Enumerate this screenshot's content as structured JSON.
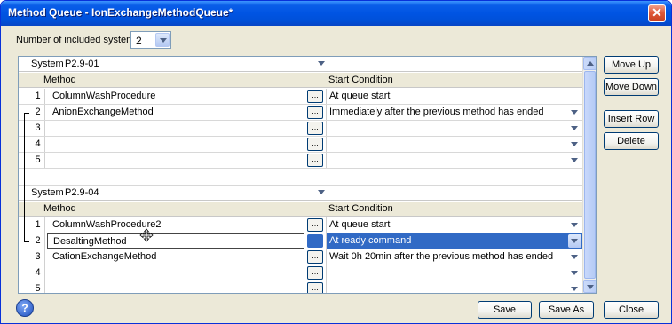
{
  "window": {
    "title": "Method Queue - IonExchangeMethodQueue*",
    "close_glyph": "✕"
  },
  "systems_count": {
    "label": "Number of included systems:",
    "value": "2"
  },
  "groups": [
    {
      "system_label": "System",
      "system_value": "P2.9-01",
      "col_method": "Method",
      "col_start": "Start Condition",
      "rows": [
        {
          "num": "1",
          "method": "ColumnWashProcedure",
          "cond": "At queue start"
        },
        {
          "num": "2",
          "method": "AnionExchangeMethod",
          "cond": "Immediately after the previous method has ended"
        },
        {
          "num": "3",
          "method": "",
          "cond": ""
        },
        {
          "num": "4",
          "method": "",
          "cond": ""
        },
        {
          "num": "5",
          "method": "",
          "cond": ""
        }
      ]
    },
    {
      "system_label": "System",
      "system_value": "P2.9-04",
      "col_method": "Method",
      "col_start": "Start Condition",
      "rows": [
        {
          "num": "1",
          "method": "ColumnWashProcedure2",
          "cond": "At queue start"
        },
        {
          "num": "2",
          "method": "DesaltingMethod",
          "cond": "At ready command"
        },
        {
          "num": "3",
          "method": "CationExchangeMethod",
          "cond": "Wait 0h 20min after the previous method has ended"
        },
        {
          "num": "4",
          "method": "",
          "cond": ""
        },
        {
          "num": "5",
          "method": "",
          "cond": ""
        }
      ]
    }
  ],
  "ellipsis_label": "...",
  "side_buttons": {
    "move_up": "Move Up",
    "move_down": "Move Down",
    "insert_row": "Insert Row",
    "delete": "Delete"
  },
  "footer": {
    "save": "Save",
    "save_as": "Save As",
    "close": "Close",
    "help_glyph": "?"
  },
  "icons": {
    "close": "close-icon",
    "help": "help-icon",
    "move_cursor": "move-cursor-icon"
  },
  "colors": {
    "title_bar": "#0054e3",
    "selection": "#316ac5",
    "close_button": "#e05a3a"
  }
}
